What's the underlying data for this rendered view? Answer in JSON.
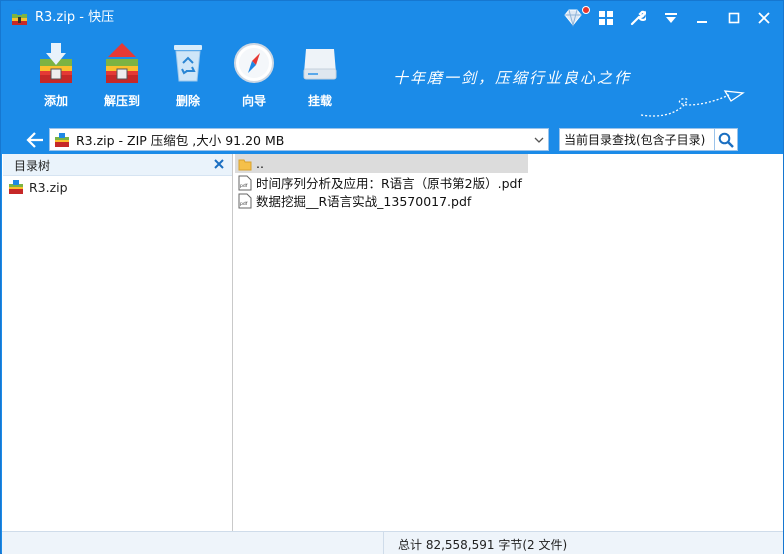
{
  "window": {
    "title": "R3.zip - 快压"
  },
  "titlebar": {
    "buttons": [
      {
        "name": "skin-icon"
      },
      {
        "name": "apps-grid-icon"
      },
      {
        "name": "wrench-icon"
      },
      {
        "name": "menu-icon"
      },
      {
        "name": "minimize-icon"
      },
      {
        "name": "maximize-icon"
      },
      {
        "name": "close-icon"
      }
    ]
  },
  "toolbar": {
    "add_label": "添加",
    "extract_label": "解压到",
    "delete_label": "删除",
    "wizard_label": "向导",
    "mount_label": "挂载",
    "slogan": "十年磨一剑，压缩行业良心之作"
  },
  "address": {
    "path": "R3.zip - ZIP 压缩包 ,大小 91.20 MB",
    "search_placeholder": "当前目录查找(包含子目录)"
  },
  "tree": {
    "header": "目录树",
    "root": "R3.zip"
  },
  "files": [
    {
      "name": "..",
      "type": "folder"
    },
    {
      "name": "时间序列分析及应用：R语言（原书第2版）.pdf",
      "type": "pdf"
    },
    {
      "name": "数据挖掘__R语言实战_13570017.pdf",
      "type": "pdf"
    }
  ],
  "status": {
    "text": "总计  82,558,591 字节(2 文件)"
  },
  "colors": {
    "accent": "#1b8be8",
    "selection": "#dcdcdc"
  }
}
